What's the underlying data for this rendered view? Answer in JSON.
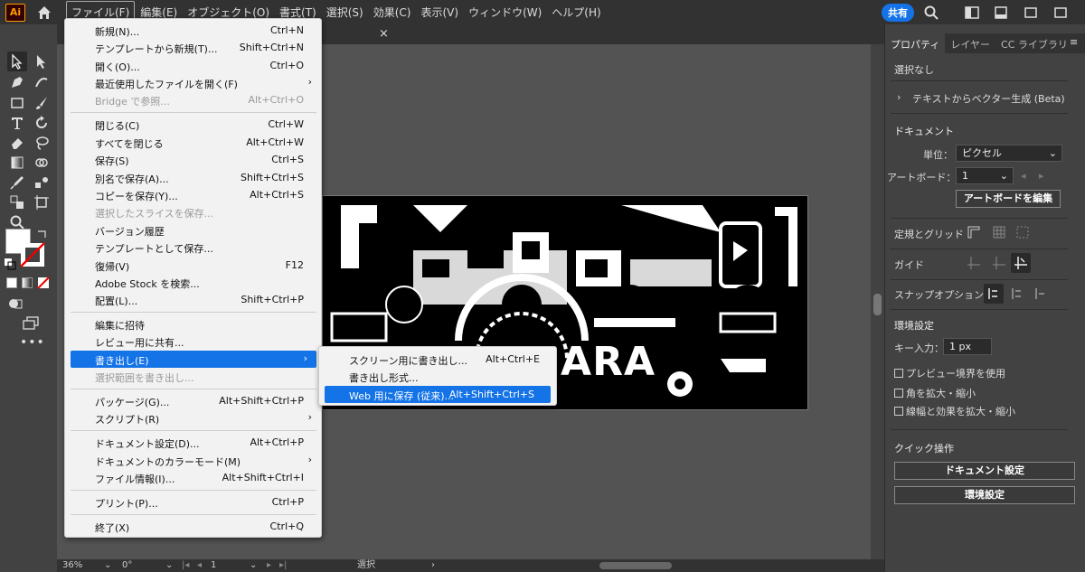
{
  "app": {
    "logo": "Ai"
  },
  "menubar": {
    "items": [
      "ファイル(F)",
      "編集(E)",
      "オブジェクト(O)",
      "書式(T)",
      "選択(S)",
      "効果(C)",
      "表示(V)",
      "ウィンドウ(W)",
      "ヘルプ(H)"
    ],
    "share_label": "共有"
  },
  "file_menu": {
    "items": [
      {
        "label": "新規(N)...",
        "shortcut": "Ctrl+N"
      },
      {
        "label": "テンプレートから新規(T)...",
        "shortcut": "Shift+Ctrl+N"
      },
      {
        "label": "開く(O)...",
        "shortcut": "Ctrl+O"
      },
      {
        "label": "最近使用したファイルを開く(F)",
        "shortcut": "›"
      },
      {
        "label": "Bridge で参照...",
        "shortcut": "Alt+Ctrl+O"
      },
      {
        "label": "閉じる(C)",
        "shortcut": "Ctrl+W"
      },
      {
        "label": "すべてを閉じる",
        "shortcut": "Alt+Ctrl+W"
      },
      {
        "label": "保存(S)",
        "shortcut": "Ctrl+S"
      },
      {
        "label": "別名で保存(A)...",
        "shortcut": "Shift+Ctrl+S"
      },
      {
        "label": "コピーを保存(Y)...",
        "shortcut": "Alt+Ctrl+S"
      },
      {
        "label": "選択したスライスを保存...",
        "shortcut": ""
      },
      {
        "label": "バージョン履歴",
        "shortcut": ""
      },
      {
        "label": "テンプレートとして保存...",
        "shortcut": ""
      },
      {
        "label": "復帰(V)",
        "shortcut": "F12"
      },
      {
        "label": "Adobe Stock を検索...",
        "shortcut": ""
      },
      {
        "label": "配置(L)...",
        "shortcut": "Shift+Ctrl+P"
      },
      {
        "label": "編集に招待",
        "shortcut": ""
      },
      {
        "label": "レビュー用に共有...",
        "shortcut": ""
      },
      {
        "label": "書き出し(E)",
        "shortcut": "›"
      },
      {
        "label": "選択範囲を書き出し...",
        "shortcut": ""
      },
      {
        "label": "パッケージ(G)...",
        "shortcut": "Alt+Shift+Ctrl+P"
      },
      {
        "label": "スクリプト(R)",
        "shortcut": "›"
      },
      {
        "label": "ドキュメント設定(D)...",
        "shortcut": "Alt+Ctrl+P"
      },
      {
        "label": "ドキュメントのカラーモード(M)",
        "shortcut": "›"
      },
      {
        "label": "ファイル情報(I)...",
        "shortcut": "Alt+Shift+Ctrl+I"
      },
      {
        "label": "プリント(P)...",
        "shortcut": "Ctrl+P"
      },
      {
        "label": "終了(X)",
        "shortcut": "Ctrl+Q"
      }
    ]
  },
  "export_submenu": {
    "items": [
      {
        "label": "スクリーン用に書き出し...",
        "shortcut": "Alt+Ctrl+E"
      },
      {
        "label": "書き出し形式...",
        "shortcut": ""
      },
      {
        "label": "Web 用に保存 (従来)...",
        "shortcut": "Alt+Shift+Ctrl+S"
      }
    ]
  },
  "doc_tab": {
    "close": "×"
  },
  "artboard": {
    "text": "A  K  I   BARA"
  },
  "statusbar": {
    "zoom": "36%",
    "rotation": "0°",
    "artboard": "1",
    "tool": "選択"
  },
  "panel": {
    "tabs": [
      "プロパティ",
      "レイヤー",
      "CC ライブラリ"
    ],
    "no_selection": "選択なし",
    "text_to_vector": "テキストからベクター生成 (Beta)",
    "document_title": "ドキュメント",
    "unit_label": "単位：",
    "unit_value": "ピクセル",
    "artboard_label": "アートボード：",
    "artboard_value": "1",
    "edit_artboard_btn": "アートボードを編集",
    "rulers_grids": "定規とグリッド",
    "guides": "ガイド",
    "snap_options": "スナップオプション",
    "preferences": "環境設定",
    "key_input_label": "キー入力：",
    "key_input_value": "1 px",
    "cb_preview_bounds": "プレビュー境界を使用",
    "cb_scale_corners": "角を拡大・縮小",
    "cb_scale_strokes": "線幅と効果を拡大・縮小",
    "quick_actions": "クイック操作",
    "doc_setup_btn": "ドキュメント設定",
    "prefs_btn": "環境設定"
  }
}
